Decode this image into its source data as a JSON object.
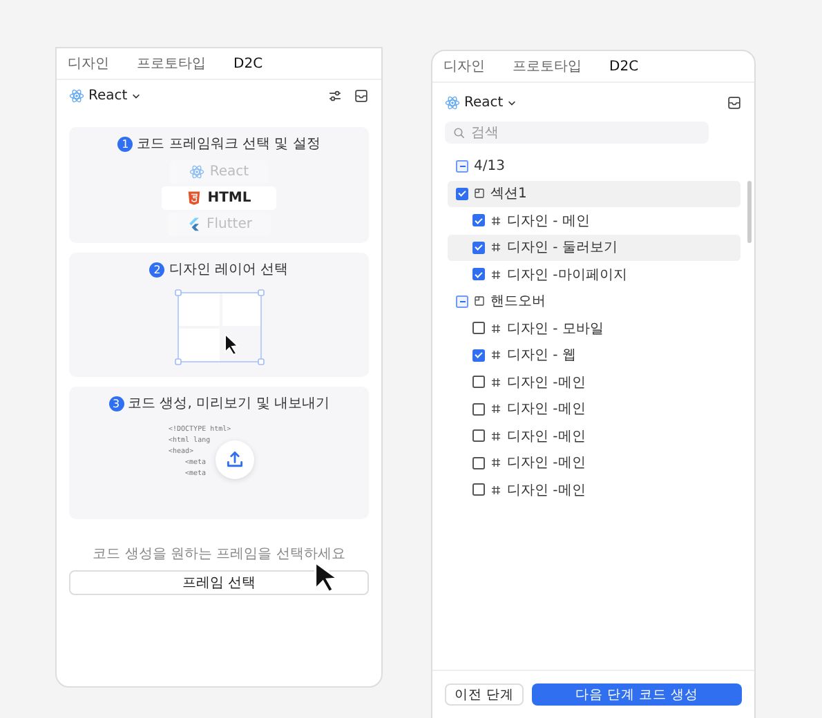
{
  "left_panel": {
    "tabs": [
      {
        "label": "디자인",
        "selected": false
      },
      {
        "label": "프로토타입",
        "selected": false
      },
      {
        "label": "D2C",
        "selected": true
      }
    ],
    "framework": "React",
    "steps": [
      {
        "number": "1",
        "title": "코드 프레임워크 선택 및 설정",
        "kind": "frameworks",
        "options": [
          {
            "label": "React",
            "selected": false,
            "kind": "react"
          },
          {
            "label": "HTML",
            "selected": true,
            "kind": "html"
          },
          {
            "label": "Flutter",
            "selected": false,
            "kind": "flutter"
          }
        ]
      },
      {
        "number": "2",
        "title": "디자인 레이어 선택",
        "kind": "layers"
      },
      {
        "number": "3",
        "title": "코드 생성, 미리보기 및 내보내기",
        "kind": "code",
        "code_lines": [
          "<!DOCTYPE html>",
          "<html lang",
          "<head>",
          "<meta",
          "<meta"
        ]
      }
    ],
    "hint": "코드 생성을 원하는 프레임을 선택하세요",
    "select_button": "프레임 선택"
  },
  "right_panel": {
    "tabs": [
      {
        "label": "디자인",
        "selected": false
      },
      {
        "label": "프로토타입",
        "selected": false
      },
      {
        "label": "D2C",
        "selected": true
      }
    ],
    "framework": "React",
    "search": {
      "placeholder": "검색"
    },
    "tree": {
      "label": "4/13",
      "partial": true,
      "children": [
        {
          "label": "섹션1",
          "checked": true,
          "partial": false,
          "selected": true,
          "children": [
            {
              "label": "디자인 - 메인",
              "checked": true,
              "selected": false
            },
            {
              "label": "디자인 - 둘러보기",
              "checked": true,
              "selected": true
            },
            {
              "label": "디자인 -마이페이지",
              "checked": true,
              "selected": false
            }
          ]
        },
        {
          "label": "핸드오버",
          "partial": true,
          "selected": false,
          "children": [
            {
              "label": "디자인 - 모바일",
              "checked": false,
              "selected": false
            },
            {
              "label": "디자인 - 웹",
              "checked": true,
              "selected": false
            },
            {
              "label": "디자인 -메인",
              "checked": false,
              "selected": false
            },
            {
              "label": "디자인 -메인",
              "checked": false,
              "selected": false
            },
            {
              "label": "디자인 -메인",
              "checked": false,
              "selected": false
            },
            {
              "label": "디자인 -메인",
              "checked": false,
              "selected": false
            },
            {
              "label": "디자인 -메인",
              "checked": false,
              "selected": false
            }
          ]
        }
      ]
    },
    "buttons": [
      {
        "label": "이전 단계",
        "kind": "secondary"
      },
      {
        "label": "다음 단계 코드 생성",
        "kind": "primary"
      }
    ]
  }
}
